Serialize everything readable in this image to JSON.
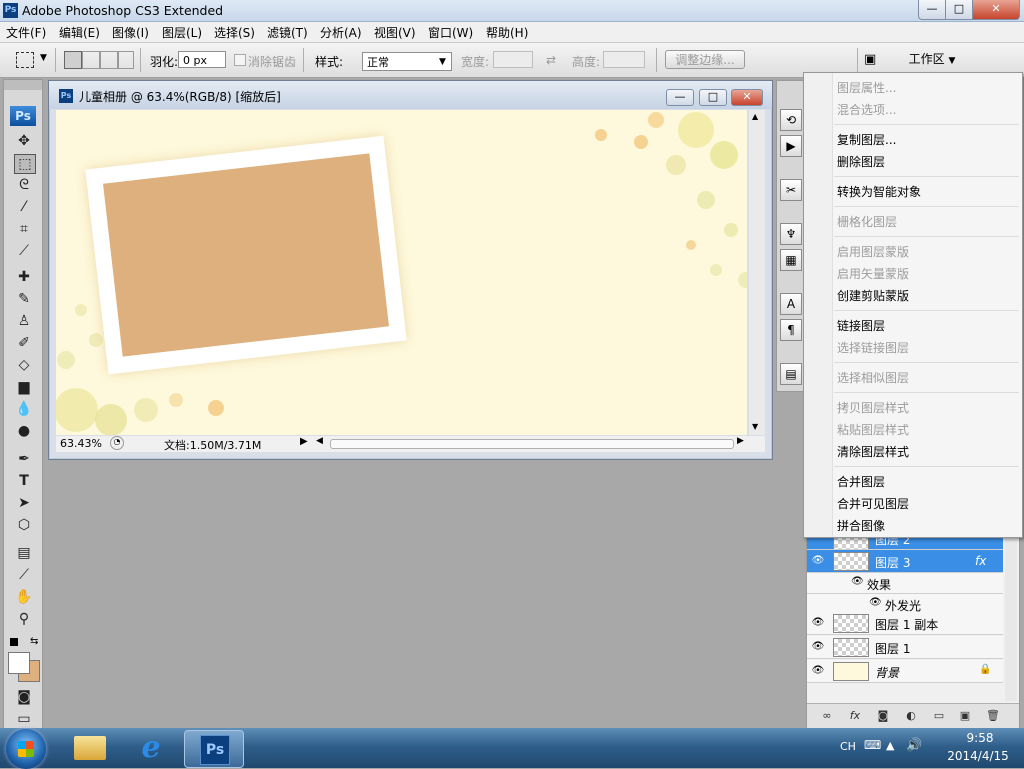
{
  "app": {
    "title": "Adobe Photoshop CS3 Extended",
    "icon_text": "Ps"
  },
  "window_controls": {
    "minimize": "—",
    "maximize": "□",
    "close": "✕"
  },
  "menus": [
    "文件(F)",
    "编辑(E)",
    "图像(I)",
    "图层(L)",
    "选择(S)",
    "滤镜(T)",
    "分析(A)",
    "视图(V)",
    "窗口(W)",
    "帮助(H)"
  ],
  "options": {
    "feather_label": "羽化:",
    "feather_value": "0 px",
    "antialias_label": "消除锯齿",
    "style_label": "样式:",
    "style_value": "正常",
    "width_label": "宽度:",
    "height_label": "高度:",
    "refine_edge": "调整边缘...",
    "workspace": "工作区"
  },
  "document": {
    "title": "儿童相册 @ 63.4%(RGB/8) [缩放后]",
    "zoom": "63.43%",
    "doc_info": "文档:1.50M/3.71M",
    "colors": {
      "bg": "#fef9dc",
      "photo": "#deb07e",
      "frame": "#ffffff"
    }
  },
  "context_menu": {
    "items": [
      {
        "label": "图层属性...",
        "enabled": false
      },
      {
        "label": "混合选项...",
        "enabled": false
      },
      {
        "label": "复制图层...",
        "enabled": true
      },
      {
        "label": "删除图层",
        "enabled": true
      },
      {
        "label": "转换为智能对象",
        "enabled": true
      },
      {
        "label": "栅格化图层",
        "enabled": false
      },
      {
        "label": "启用图层蒙版",
        "enabled": false
      },
      {
        "label": "启用矢量蒙版",
        "enabled": false
      },
      {
        "label": "创建剪贴蒙版",
        "enabled": true
      },
      {
        "label": "链接图层",
        "enabled": true
      },
      {
        "label": "选择链接图层",
        "enabled": false
      },
      {
        "label": "选择相似图层",
        "enabled": false
      },
      {
        "label": "拷贝图层样式",
        "enabled": false
      },
      {
        "label": "粘贴图层样式",
        "enabled": false
      },
      {
        "label": "清除图层样式",
        "enabled": true
      },
      {
        "label": "合并图层",
        "enabled": true
      },
      {
        "label": "合并可见图层",
        "enabled": true
      },
      {
        "label": "拼合图像",
        "enabled": true
      }
    ]
  },
  "layers": {
    "partial_top": "图层 2",
    "selected": "图层 3",
    "fx": "fx",
    "effects_label": "效果",
    "effect_outer_glow": "外发光",
    "layer1_copy": "图层 1 副本",
    "layer1": "图层 1",
    "background": "背景"
  },
  "taskbar": {
    "lang": "CH",
    "time": "9:58",
    "date": "2014/4/15"
  }
}
